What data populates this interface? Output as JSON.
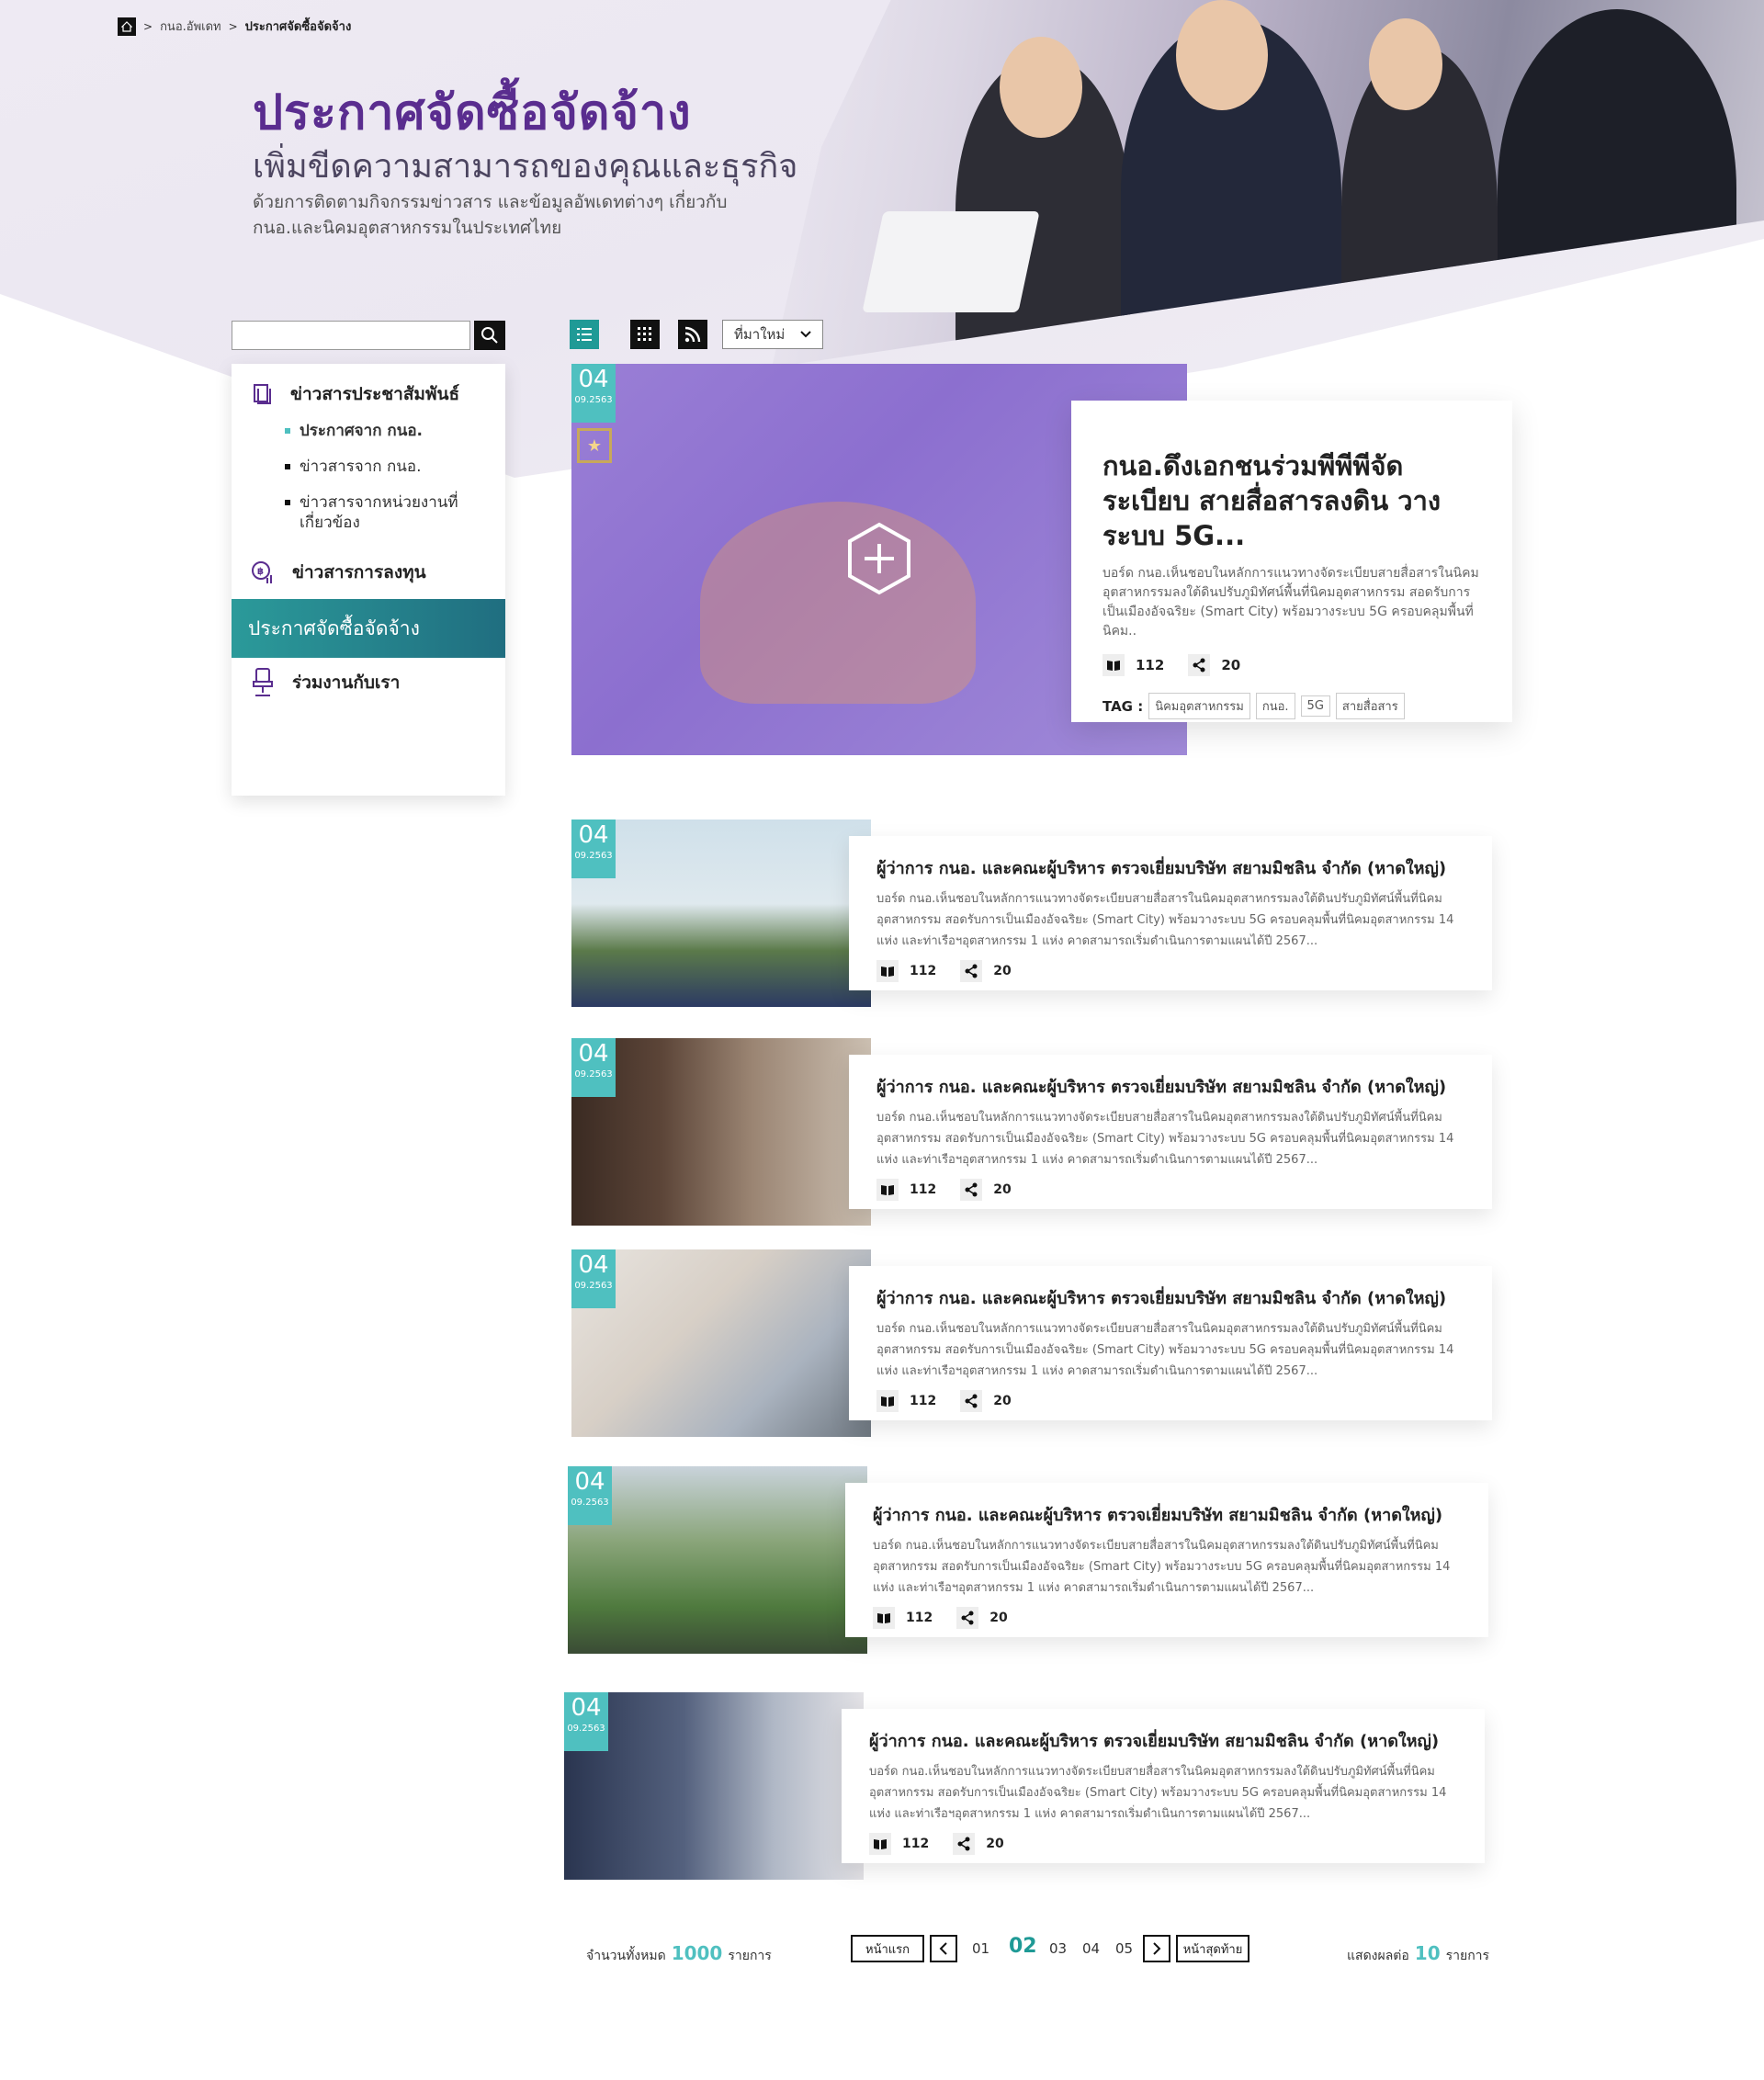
{
  "breadcrumb": {
    "home": "home",
    "items": [
      "กนอ.อัพเดท",
      "ประกาศจัดซื้อจัดจ้าง"
    ]
  },
  "hero": {
    "title": "ประกาศจัดซื้อจัดจ้าง",
    "subtitle": "เพิ่มขีดความสามารถของคุณและธุรกิจ",
    "desc": "ด้วยการติดตามกิจกรรมข่าวสาร และข้อมูลอัพเดทต่างๆ เกี่ยวกับ กนอ.และนิคมอุตสาหกรรมในประเทศไทย"
  },
  "search": {
    "placeholder": ""
  },
  "sidebar": {
    "sections": [
      {
        "label": "ข่าวสารประชาสัมพันธ์",
        "icon": "document-icon",
        "items": [
          "ประกาศจาก กนอ.",
          "ข่าวสารจาก กนอ.",
          "ข่าวสารจากหน่วยงานที่เกี่ยวข้อง"
        ]
      },
      {
        "label": "ข่าวสารการลงทุน",
        "icon": "investment-icon"
      },
      {
        "label": "ประกาศจัดซื้อจัดจ้าง",
        "active": true
      },
      {
        "label": "ร่วมงานกับเรา",
        "icon": "chair-icon"
      }
    ]
  },
  "toolbar": {
    "sort": "ที่มาใหม่"
  },
  "featured": {
    "day": "04",
    "date": "09.2563",
    "title": "กนอ.ดึงเอกชนร่วมพีพีพีจัดระเบียบ สายสื่อสารลงดิน วางระบบ 5G...",
    "text": "บอร์ด กนอ.เห็นชอบในหลักการแนวทางจัดระเบียบสายสื่อสารในนิคมอุตสาหกรรมลงใต้ดินปรับภูมิทัศน์พื้นที่นิคมอุตสาหกรรม สอดรับการเป็นเมืองอัจฉริยะ (Smart City) พร้อมวางระบบ 5G ครอบคลุมพื้นที่นิคม..",
    "views": "112",
    "shares": "20",
    "tag_label": "TAG :",
    "tags": [
      "นิคมอุตสาหกรรม",
      "กนอ.",
      "5G",
      "สายสื่อสาร"
    ]
  },
  "news": [
    {
      "day": "04",
      "date": "09.2563",
      "title": "ผู้ว่าการ กนอ. และคณะผู้บริหาร ตรวจเยี่ยมบริษัท สยามมิชลิน จำกัด (หาดใหญ่)",
      "text": "บอร์ด กนอ.เห็นชอบในหลักการแนวทางจัดระเบียบสายสื่อสารในนิคมอุตสาหกรรมลงใต้ดินปรับภูมิทัศน์พื้นที่นิคมอุตสาหกรรม สอดรับการเป็นเมืองอัจฉริยะ (Smart City) พร้อมวางระบบ 5G ครอบคลุมพื้นที่นิคมอุตสาหกรรม 14 แห่ง และท่าเรือฯอุตสาหกรรม 1 แห่ง คาดสามารถเริ่มดำเนินการตามแผนได้ปี 2567...",
      "views": "112",
      "shares": "20",
      "thumb": "tire"
    },
    {
      "day": "04",
      "date": "09.2563",
      "title": "ผู้ว่าการ กนอ. และคณะผู้บริหาร ตรวจเยี่ยมบริษัท สยามมิชลิน จำกัด (หาดใหญ่)",
      "text": "บอร์ด กนอ.เห็นชอบในหลักการแนวทางจัดระเบียบสายสื่อสารในนิคมอุตสาหกรรมลงใต้ดินปรับภูมิทัศน์พื้นที่นิคมอุตสาหกรรม สอดรับการเป็นเมืองอัจฉริยะ (Smart City) พร้อมวางระบบ 5G ครอบคลุมพื้นที่นิคมอุตสาหกรรม 14 แห่ง และท่าเรือฯอุตสาหกรรม 1 แห่ง คาดสามารถเริ่มดำเนินการตามแผนได้ปี 2567...",
      "views": "112",
      "shares": "20",
      "thumb": "office"
    },
    {
      "day": "04",
      "date": "09.2563",
      "title": "ผู้ว่าการ กนอ. และคณะผู้บริหาร ตรวจเยี่ยมบริษัท สยามมิชลิน จำกัด (หาดใหญ่)",
      "text": "บอร์ด กนอ.เห็นชอบในหลักการแนวทางจัดระเบียบสายสื่อสารในนิคมอุตสาหกรรมลงใต้ดินปรับภูมิทัศน์พื้นที่นิคมอุตสาหกรรม สอดรับการเป็นเมืองอัจฉริยะ (Smart City) พร้อมวางระบบ 5G ครอบคลุมพื้นที่นิคมอุตสาหกรรม 14 แห่ง และท่าเรือฯอุตสาหกรรม 1 แห่ง คาดสามารถเริ่มดำเนินการตามแผนได้ปี 2567...",
      "views": "112",
      "shares": "20",
      "thumb": "handshake"
    },
    {
      "day": "04",
      "date": "09.2563",
      "title": "ผู้ว่าการ กนอ. และคณะผู้บริหาร ตรวจเยี่ยมบริษัท สยามมิชลิน จำกัด (หาดใหญ่)",
      "text": "บอร์ด กนอ.เห็นชอบในหลักการแนวทางจัดระเบียบสายสื่อสารในนิคมอุตสาหกรรมลงใต้ดินปรับภูมิทัศน์พื้นที่นิคมอุตสาหกรรม สอดรับการเป็นเมืองอัจฉริยะ (Smart City) พร้อมวางระบบ 5G ครอบคลุมพื้นที่นิคมอุตสาหกรรม 14 แห่ง และท่าเรือฯอุตสาหกรรม 1 แห่ง คาดสามารถเริ่มดำเนินการตามแผนได้ปี 2567...",
      "views": "112",
      "shares": "20",
      "thumb": "trees"
    },
    {
      "day": "04",
      "date": "09.2563",
      "title": "ผู้ว่าการ กนอ. และคณะผู้บริหาร ตรวจเยี่ยมบริษัท สยามมิชลิน จำกัด (หาดใหญ่)",
      "text": "บอร์ด กนอ.เห็นชอบในหลักการแนวทางจัดระเบียบสายสื่อสารในนิคมอุตสาหกรรมลงใต้ดินปรับภูมิทัศน์พื้นที่นิคมอุตสาหกรรม สอดรับการเป็นเมืองอัจฉริยะ (Smart City) พร้อมวางระบบ 5G ครอบคลุมพื้นที่นิคมอุตสาหกรรม 14 แห่ง และท่าเรือฯอุตสาหกรรม 1 แห่ง คาดสามารถเริ่มดำเนินการตามแผนได้ปี 2567...",
      "views": "112",
      "shares": "20",
      "thumb": "meeting"
    }
  ],
  "pagination": {
    "total_label": "จำนวนทั้งหมด",
    "total": "1000",
    "unit": "รายการ",
    "first": "หน้าแรก",
    "last": "หน้าสุดท้าย",
    "pages": [
      "01",
      "02",
      "03",
      "04",
      "05"
    ],
    "current": "02",
    "per_label": "แสดงผลต่อ",
    "per": "10"
  },
  "colors": {
    "accent": "#4fc0c0",
    "brand": "#5a2d8f",
    "active_nav": "#2b9a9a",
    "feature_bg": "#9a7fd6"
  }
}
